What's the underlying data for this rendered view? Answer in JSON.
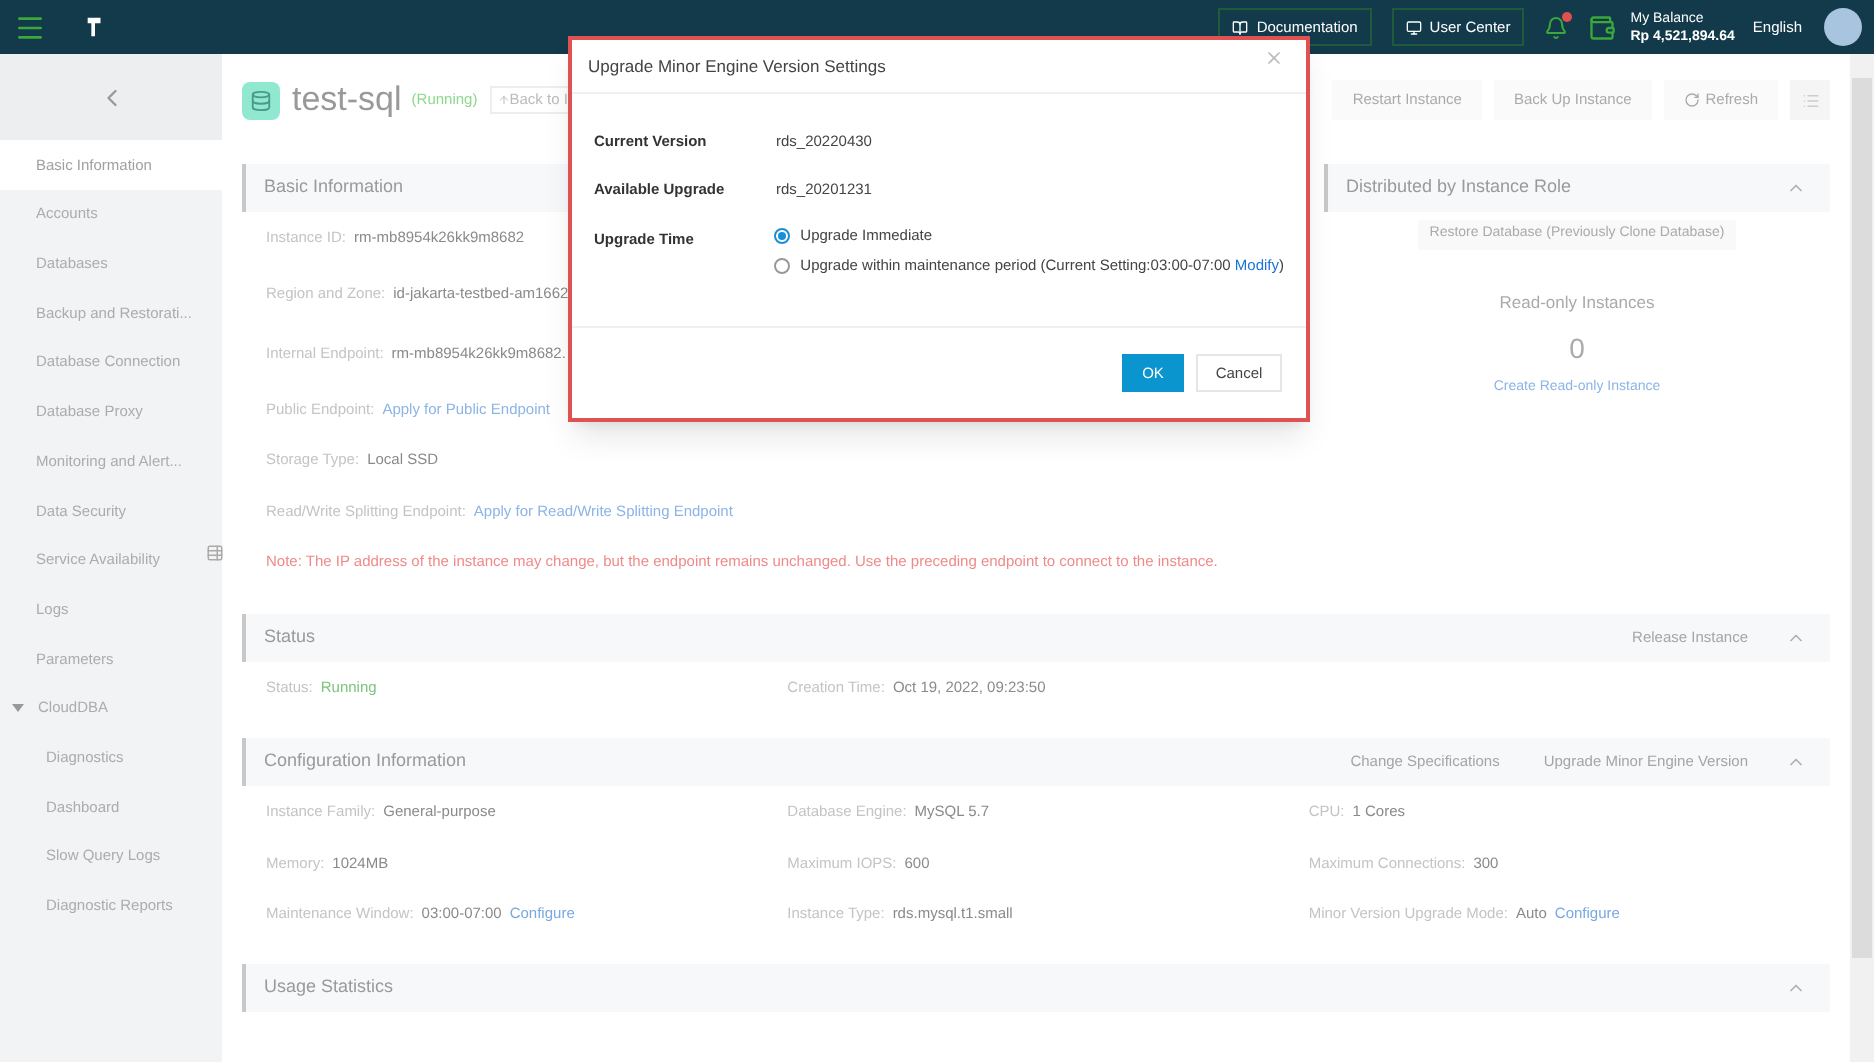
{
  "header": {
    "documentation": "Documentation",
    "user_center": "User Center",
    "balance_label": "My Balance",
    "balance": "Rp 4,521,894.64",
    "language": "English",
    "notification_dot": true
  },
  "sidebar": {
    "items": [
      {
        "label": "Basic Information",
        "selected": true
      },
      {
        "label": "Accounts",
        "selected": false
      },
      {
        "label": "Databases",
        "selected": false
      },
      {
        "label": "Backup and Restorati...",
        "selected": false
      },
      {
        "label": "Database Connection",
        "selected": false
      },
      {
        "label": "Database Proxy",
        "selected": false
      },
      {
        "label": "Monitoring and Alert...",
        "selected": false
      },
      {
        "label": "Data Security",
        "selected": false
      },
      {
        "label": "Service Availability",
        "selected": false
      },
      {
        "label": "Logs",
        "selected": false
      },
      {
        "label": "Parameters",
        "selected": false
      },
      {
        "label": "CloudDBA",
        "selected": false,
        "expanded": true,
        "children": [
          {
            "label": "Diagnostics",
            "selected": false
          },
          {
            "label": "Dashboard",
            "selected": false
          },
          {
            "label": "Slow Query Logs",
            "selected": false
          },
          {
            "label": "Diagnostic Reports",
            "selected": false
          }
        ]
      }
    ]
  },
  "instance": {
    "name": "test-sql",
    "status": "(Running)",
    "back": "Back to I"
  },
  "toolbar": [
    "Restart Instance",
    "Back Up Instance",
    "Refresh"
  ],
  "basic_information": {
    "title": "Basic Information",
    "rows": [
      {
        "label": "Instance ID:",
        "value": "rm-mb8954k26kk9m8682",
        "kind": "text"
      },
      {
        "label": "Region and Zone:",
        "value": "id-jakarta-testbed-am1662",
        "kind": "text"
      },
      {
        "label": "Internal Endpoint:",
        "value": "rm-mb8954k26kk9m8682.",
        "kind": "text"
      },
      {
        "label": "Public Endpoint:",
        "value": "Apply for Public Endpoint",
        "kind": "link"
      },
      {
        "label": "Storage Type:",
        "value": "Local SSD",
        "kind": "text"
      },
      {
        "label": "Read/Write Splitting Endpoint:",
        "value": "Apply for Read/Write Splitting Endpoint",
        "kind": "link"
      }
    ],
    "note": "Note: The IP address of the instance may change, but the endpoint remains unchanged. Use the preceding endpoint to connect to the instance."
  },
  "distributed": {
    "title": "Distributed by Instance Role",
    "expanded": true,
    "restore": "Restore Database (Previously Clone Database)",
    "readonly_title": "Read-only Instances",
    "readonly_count": "0",
    "create_link": "Create Read-only Instance"
  },
  "status_section": {
    "title": "Status",
    "expanded": true,
    "actions": [
      "Release Instance"
    ],
    "fields": [
      {
        "label": "Status:",
        "value": "Running",
        "kind": "status"
      },
      {
        "label": "Creation Time:",
        "value": "Oct 19, 2022, 09:23:50",
        "kind": "text"
      }
    ]
  },
  "configuration": {
    "title": "Configuration Information",
    "expanded": true,
    "actions": [
      "Change Specifications",
      "Upgrade Minor Engine Version"
    ],
    "fields": [
      {
        "label": "Instance Family:",
        "value": "General-purpose",
        "kind": "text"
      },
      {
        "label": "Database Engine:",
        "value": "MySQL 5.7",
        "kind": "text"
      },
      {
        "label": "CPU:",
        "value": "1 Cores",
        "kind": "text"
      },
      {
        "label": "Memory:",
        "value": "1024MB",
        "kind": "text"
      },
      {
        "label": "Maximum IOPS:",
        "value": "600",
        "kind": "text"
      },
      {
        "label": "Maximum Connections:",
        "value": "300",
        "kind": "text"
      },
      {
        "label": "Maintenance Window:",
        "value": "03:00-07:00",
        "kind": "text",
        "link": "Configure"
      },
      {
        "label": "Instance Type:",
        "value": "rds.mysql.t1.small",
        "kind": "text"
      },
      {
        "label": "Minor Version Upgrade Mode:",
        "value": "Auto",
        "kind": "text",
        "link": "Configure"
      }
    ]
  },
  "usage": {
    "title": "Usage Statistics",
    "expanded": true
  },
  "dialog": {
    "title": "Upgrade Minor Engine Version Settings",
    "rows": [
      {
        "label": "Current Version",
        "value": "rds_20220430"
      },
      {
        "label": "Available Upgrade",
        "value": "rds_20201231"
      }
    ],
    "time_label": "Upgrade Time",
    "options": [
      {
        "label": "Upgrade Immediate",
        "selected": true
      },
      {
        "label": "Upgrade within maintenance period (Current Setting:03:00-07:00",
        "link": "Modify",
        "after": ")",
        "selected": false
      }
    ],
    "ok": "OK",
    "cancel": "Cancel"
  }
}
